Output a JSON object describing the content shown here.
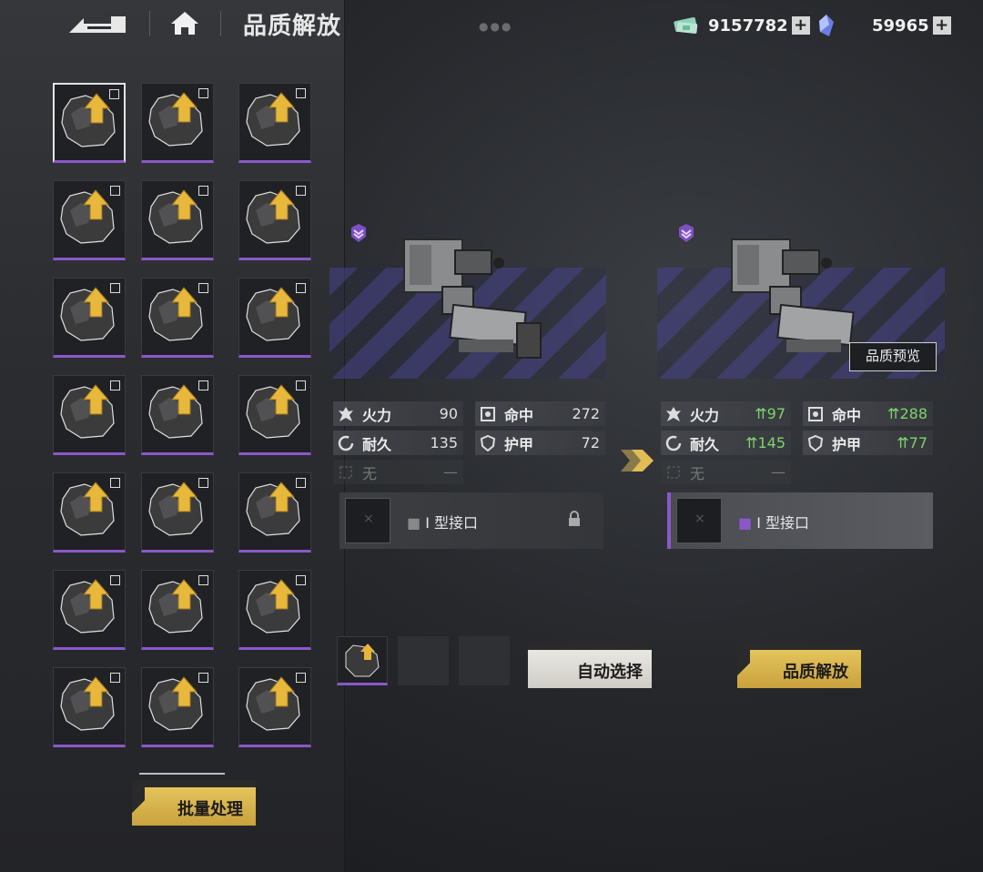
{
  "header": {
    "title": "品质解放",
    "currency1": {
      "icon": "cash-icon",
      "value": "9157782"
    },
    "currency2": {
      "icon": "crystal-icon",
      "value": "59965"
    }
  },
  "materials": {
    "rows": 7,
    "cols": 3,
    "selected_index": 0
  },
  "buttons": {
    "batch": "批量处理",
    "auto_select": "自动选择",
    "liberate": "品质解放",
    "preview": "品质预览"
  },
  "current": {
    "stats": {
      "firepower": {
        "label": "火力",
        "value": "90"
      },
      "accuracy": {
        "label": "命中",
        "value": "272"
      },
      "durability": {
        "label": "耐久",
        "value": "135"
      },
      "armor": {
        "label": "护甲",
        "value": "72"
      },
      "none": {
        "label": "无",
        "value": "—"
      }
    },
    "slot_label": "Ⅰ 型接口"
  },
  "result": {
    "stats": {
      "firepower": {
        "label": "火力",
        "value": "97"
      },
      "accuracy": {
        "label": "命中",
        "value": "288"
      },
      "durability": {
        "label": "耐久",
        "value": "145"
      },
      "armor": {
        "label": "护甲",
        "value": "77"
      },
      "none": {
        "label": "无",
        "value": "—"
      }
    },
    "slot_label": "Ⅰ 型接口"
  },
  "colors": {
    "accent_gold": "#e0bd55",
    "rarity_purple": "#8a58c8",
    "stat_up_green": "#7ed36d"
  }
}
